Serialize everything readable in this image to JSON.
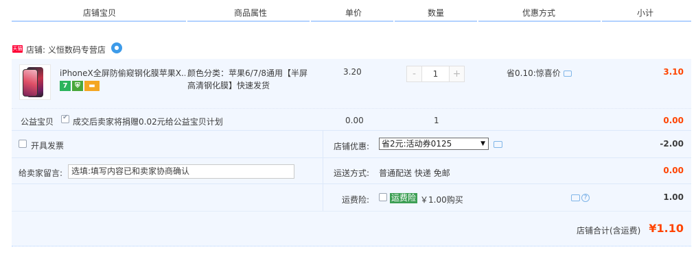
{
  "header": {
    "columns": [
      "店铺宝贝",
      "商品属性",
      "单价",
      "数量",
      "优惠方式",
      "小计"
    ]
  },
  "shop": {
    "tag": "天猫",
    "label": "店铺: 义恒数码专营店"
  },
  "item": {
    "title": "iPhoneX全屏防偷窥钢化膜苹果X...",
    "sku": "颜色分类：苹果6/7/8通用【半屏高清钢化膜】快速发货",
    "price": "3.20",
    "quantity": "1",
    "qty_minus": "-",
    "qty_plus": "+",
    "promo": "省0.10:惊喜价",
    "subtotal": "3.10",
    "badge_7": "7"
  },
  "charity": {
    "label": "公益宝贝",
    "text": "成交后卖家将捐赠0.02元给公益宝贝计划",
    "price": "0.00",
    "quantity": "1",
    "subtotal": "0.00"
  },
  "invoice": {
    "label": "开具发票"
  },
  "message": {
    "label": "给卖家留言:",
    "placeholder": "选填:填写内容已和卖家协商确认"
  },
  "shop_discount": {
    "label": "店铺优惠:",
    "selected": "省2元:活动券0125",
    "value": "-2.00"
  },
  "shipping": {
    "label": "运送方式:",
    "text": "普通配送 快递 免邮",
    "value": "0.00"
  },
  "insurance": {
    "label": "运费险:",
    "tag": "运费险",
    "text": "￥1.00购买",
    "value": "1.00"
  },
  "total": {
    "label": "店铺合计(含运费)",
    "value": "¥1.10"
  },
  "colors": {
    "accent_red": "#ff4400",
    "panel_bg": "#f2f7ff",
    "header_line": "#b2d1ff",
    "insurance_green": "#3d9f55"
  }
}
